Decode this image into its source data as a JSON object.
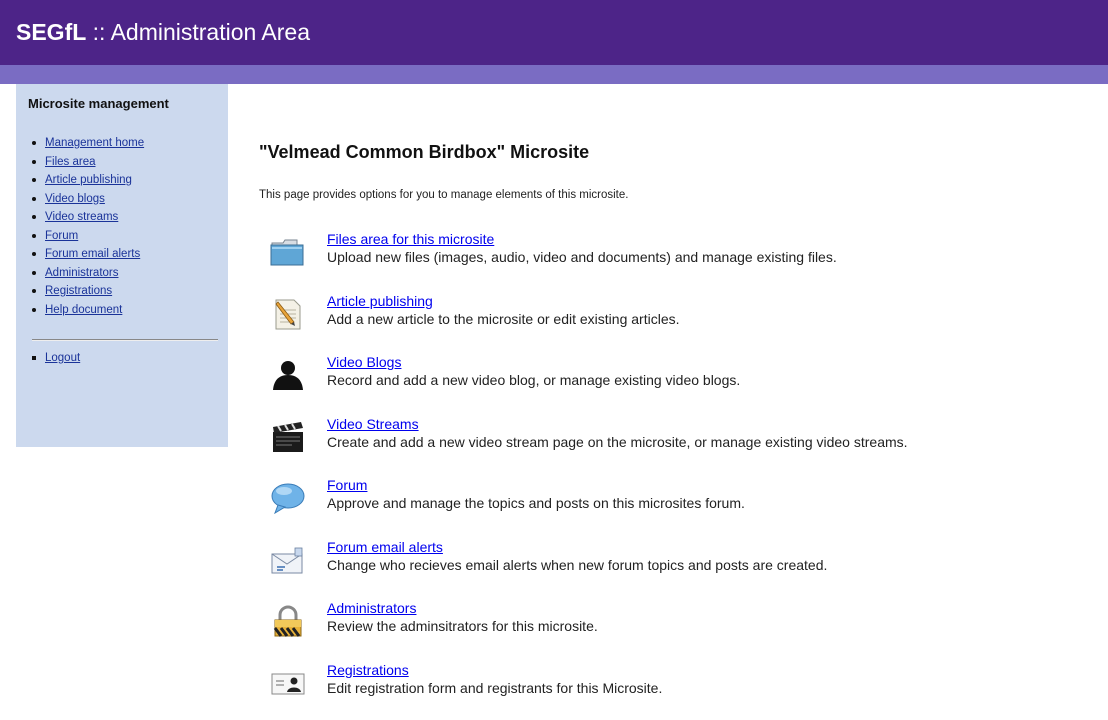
{
  "header": {
    "brand": "SEGfL",
    "separator": "::",
    "subtitle": "Administration Area"
  },
  "sidebar": {
    "title": "Microsite management",
    "items": [
      {
        "label": "Management home"
      },
      {
        "label": "Files area"
      },
      {
        "label": "Article publishing"
      },
      {
        "label": "Video blogs"
      },
      {
        "label": "Video streams"
      },
      {
        "label": "Forum"
      },
      {
        "label": "Forum email alerts"
      },
      {
        "label": "Administrators"
      },
      {
        "label": "Registrations"
      },
      {
        "label": "Help document"
      }
    ],
    "logout_label": "Logout"
  },
  "main": {
    "title": "\"Velmead Common Birdbox\" Microsite",
    "intro": "This page provides options for you to manage elements of this microsite.",
    "options": [
      {
        "icon": "folder-icon",
        "title": "Files area for this microsite",
        "description": "Upload new files (images, audio, video and documents) and manage existing files."
      },
      {
        "icon": "article-edit-icon",
        "title": "Article publishing",
        "description": "Add a new article to the microsite or edit existing articles."
      },
      {
        "icon": "person-icon",
        "title": "Video Blogs",
        "description": "Record and add a new video blog, or manage existing video blogs."
      },
      {
        "icon": "clapperboard-icon",
        "title": "Video Streams",
        "description": "Create and add a new video stream page on the microsite, or manage existing video streams."
      },
      {
        "icon": "speech-bubble-icon",
        "title": "Forum",
        "description": "Approve and manage the topics and posts on this microsites forum."
      },
      {
        "icon": "email-icon",
        "title": "Forum email alerts",
        "description": "Change who recieves email alerts when new forum topics and posts are created."
      },
      {
        "icon": "padlock-icon",
        "title": "Administrators",
        "description": "Review the adminsitrators for this microsite."
      },
      {
        "icon": "id-card-icon",
        "title": "Registrations",
        "description": "Edit registration form and registrants for this Microsite."
      }
    ]
  },
  "colors": {
    "header_bg": "#4d2488",
    "subbar_bg": "#7a6cc3",
    "sidebar_bg": "#ccd9ee",
    "link": "#1a3399"
  }
}
